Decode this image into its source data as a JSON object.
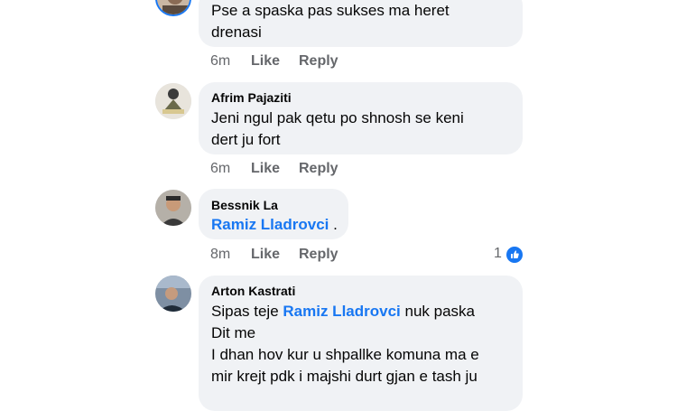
{
  "comments": [
    {
      "author": "",
      "text_lines": [
        "Pse a spaska pas sukses ma heret",
        "drenasi"
      ],
      "time": "6m",
      "like": "Like",
      "reply": "Reply"
    },
    {
      "author": "Afrim Pajaziti",
      "text_lines": [
        "Jeni ngul pak qetu po shnosh se keni",
        "dert ju fort"
      ],
      "time": "6m",
      "like": "Like",
      "reply": "Reply"
    },
    {
      "author": "Bessnik La",
      "mention": "Ramiz Lladrovci",
      "after_mention": " .",
      "time": "8m",
      "like": "Like",
      "reply": "Reply",
      "reaction_count": "1"
    },
    {
      "author": "Arton Kastrati",
      "line1_prefix": "Sipas teje ",
      "mention": "Ramiz Lladrovci",
      "line1_suffix": " nuk paska",
      "text_lines": [
        "Dit me",
        "I dhan hov kur u shpallke komuna ma e",
        "mir krejt pdk i majshi durt gjan e tash ju"
      ]
    }
  ],
  "colors": {
    "bubble": "#f0f2f5",
    "mention": "#1877f2",
    "meta": "#65676b",
    "like_badge": "#1877f2"
  },
  "icons": [
    "avatar-1",
    "avatar-afrim",
    "avatar-bessnik",
    "avatar-arton",
    "thumbs-up-icon"
  ]
}
